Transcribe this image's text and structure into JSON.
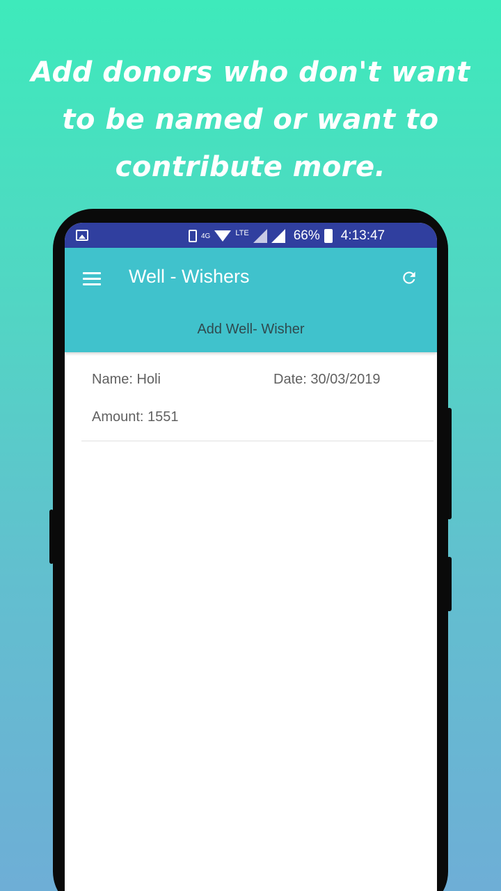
{
  "headline": {
    "line1": "Add donors who don't want",
    "line2": "to be named or want to",
    "line3": "contribute more."
  },
  "status_bar": {
    "network_4g": "4G",
    "network_lte": "LTE",
    "battery": "66%",
    "time": "4:13:47"
  },
  "app_bar": {
    "title": "Well - Wishers",
    "add_label": "Add Well- Wisher"
  },
  "records": [
    {
      "name": "Name: Holi",
      "date": "Date: 30/03/2019",
      "amount": "Amount: 1551"
    }
  ],
  "colors": {
    "background_top": "#3EEABB",
    "background_bottom": "#6EAED6",
    "status_bar": "#303F9F",
    "app_bar": "#40C2CC"
  }
}
